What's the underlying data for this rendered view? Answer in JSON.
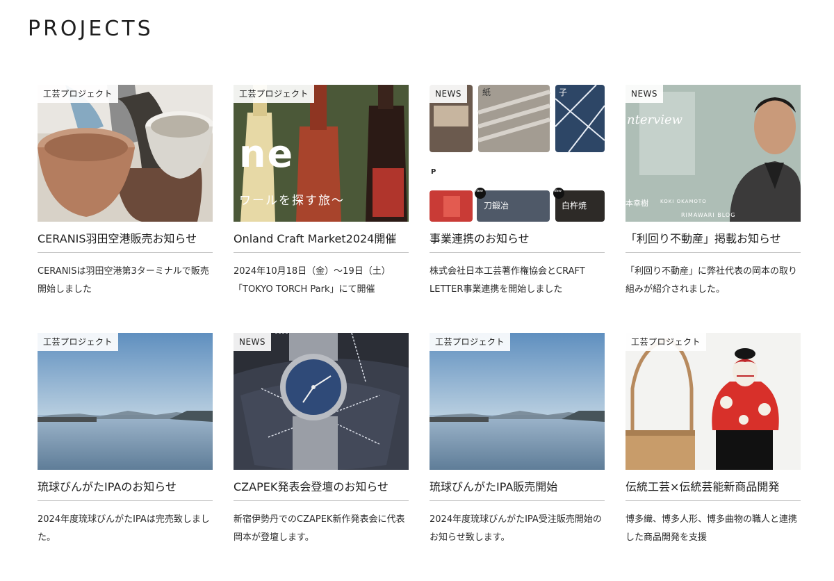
{
  "page": {
    "title": "PROJECTS"
  },
  "cards": [
    {
      "tag": "工芸プロジェクト",
      "title": "CERANIS羽田空港販売お知らせ",
      "desc": "CERANISは羽田空港第3ターミナルで販売開始しました",
      "image": "ceramic-cups"
    },
    {
      "tag": "工芸プロジェクト",
      "title": "Onland Craft Market2024開催",
      "desc": "2024年10月18日（金）〜19日（土）「TOKYO TORCH Park」にて開催",
      "image": "wine-bottles",
      "overlay_big": "ne",
      "overlay_sub": "ワールを探す旅〜"
    },
    {
      "tag": "NEWS",
      "title": "事業連携のお知らせ",
      "desc": "株式会社日本工芸著作権協会とCRAFT LETTER事業連携を開始しました",
      "image": "craft-letter-collage",
      "overlay_chars": [
        "紙",
        "子",
        "P",
        "刀鍛冶",
        "白杵焼"
      ],
      "overlay_badge": "New"
    },
    {
      "tag": "NEWS",
      "title": "「利回り不動産」掲載お知らせ",
      "desc": "「利回り不動産」に弊社代表の岡本の取り組みが紹介されました。",
      "image": "interview-portrait",
      "overlay_script": "nterview",
      "overlay_caption": "KOKI OKAMOTO",
      "overlay_blog": "RIMAWARI BLOG",
      "overlay_name": "本幸樹"
    },
    {
      "tag": "工芸プロジェクト",
      "title": "琉球びんがたIPAのお知らせ",
      "desc": "2024年度琉球びんがたIPAは完売致しました。",
      "image": "sea-landscape"
    },
    {
      "tag": "NEWS",
      "title": "CZAPEK発表会登壇のお知らせ",
      "desc": "新宿伊勢丹でのCZAPEK新作発表会に代表岡本が登壇します。",
      "image": "watch-cushion"
    },
    {
      "tag": "工芸プロジェクト",
      "title": "琉球びんがたIPA販売開始",
      "desc": "2024年度琉球びんがたIPA受注販売開始のお知らせ致します。",
      "image": "sea-landscape"
    },
    {
      "tag": "工芸プロジェクト",
      "title": "伝統工芸×伝統芸能新商品開発",
      "desc": "博多織、博多人形、博多曲物の職人と連携した商品開発を支援",
      "image": "kabuki-doll"
    }
  ]
}
